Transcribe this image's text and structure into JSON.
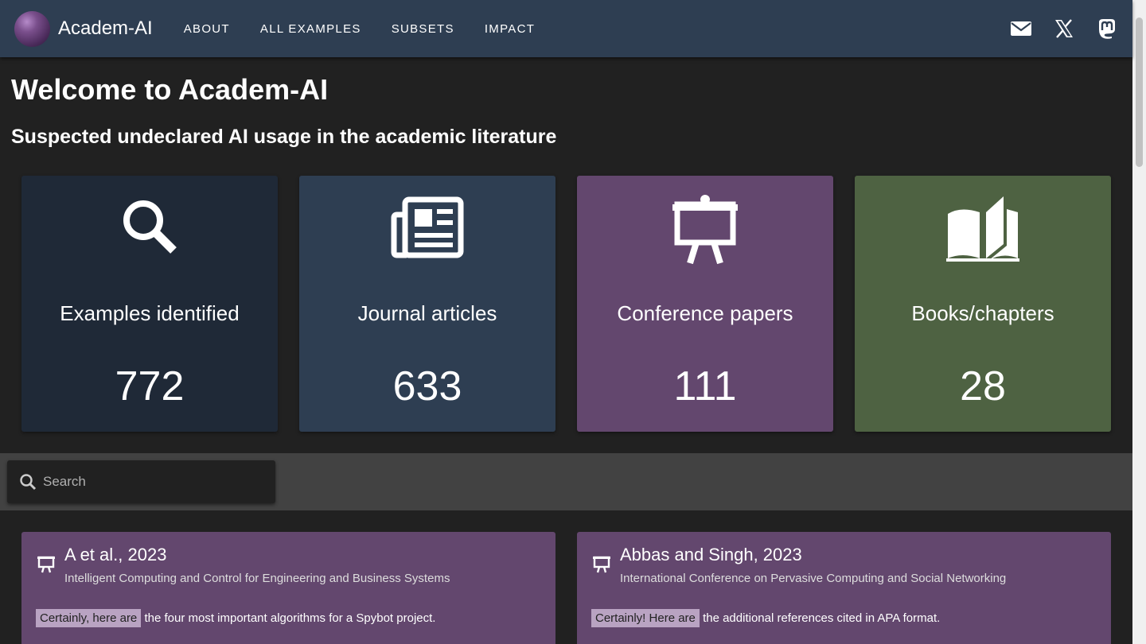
{
  "nav": {
    "brand": "Academ-AI",
    "links": [
      "ABOUT",
      "ALL EXAMPLES",
      "SUBSETS",
      "IMPACT"
    ],
    "icons": [
      "mail-icon",
      "x-icon",
      "mastodon-icon"
    ]
  },
  "page": {
    "title": "Welcome to Academ-AI",
    "subtitle": "Suspected undeclared AI usage in the academic literature"
  },
  "stats": [
    {
      "label": "Examples identified",
      "count": "772",
      "icon": "search-icon",
      "color": "#1f2937"
    },
    {
      "label": "Journal articles",
      "count": "633",
      "icon": "newspaper-icon",
      "color": "#2e3e52"
    },
    {
      "label": "Conference papers",
      "count": "111",
      "icon": "presentation-icon",
      "color": "#63476e"
    },
    {
      "label": "Books/chapters",
      "count": "28",
      "icon": "book-icon",
      "color": "#4e6242"
    }
  ],
  "search": {
    "placeholder": "Search"
  },
  "results": [
    {
      "title": "A et al., 2023",
      "venue": "Intelligent Computing and Control for Engineering and Business Systems",
      "highlight": "Certainly, here are",
      "snippet": "the four most important algorithms for a Spybot project."
    },
    {
      "title": "Abbas and Singh, 2023",
      "venue": "International Conference on Pervasive Computing and Social Networking",
      "highlight": "Certainly! Here are",
      "snippet": "the additional references cited in APA format."
    }
  ]
}
